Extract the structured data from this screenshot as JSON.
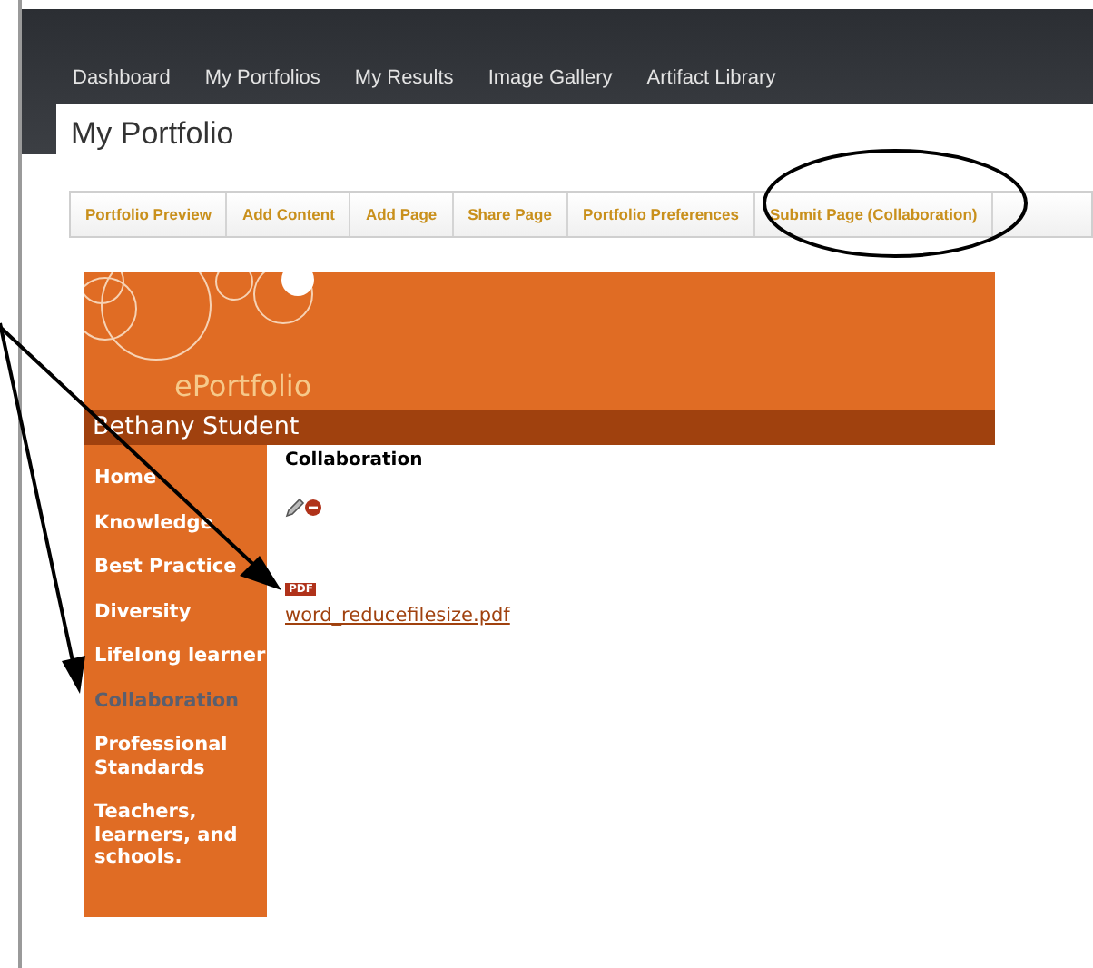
{
  "nav": [
    {
      "label": "Dashboard"
    },
    {
      "label": "My Portfolios"
    },
    {
      "label": "My Results"
    },
    {
      "label": "Image Gallery"
    },
    {
      "label": "Artifact Library"
    }
  ],
  "page_title": "My Portfolio",
  "tabs": [
    {
      "label": "Portfolio Preview"
    },
    {
      "label": "Add Content"
    },
    {
      "label": "Add Page"
    },
    {
      "label": "Share Page"
    },
    {
      "label": "Portfolio Preferences"
    },
    {
      "label": "Submit Page (Collaboration)"
    }
  ],
  "banner": {
    "title": "ePortfolio",
    "name": "Bethany Student"
  },
  "sidebar": {
    "items": [
      {
        "label": "Home",
        "selected": false
      },
      {
        "label": "Knowledge",
        "selected": false
      },
      {
        "label": "Best Practice",
        "selected": false
      },
      {
        "label": "Diversity",
        "selected": false
      },
      {
        "label": "Lifelong learner",
        "selected": false
      },
      {
        "label": "Collaboration",
        "selected": true
      },
      {
        "label": "Professional Standards",
        "selected": false
      },
      {
        "label": "Teachers, learners, and schools.",
        "selected": false
      }
    ]
  },
  "content": {
    "heading": "Collaboration",
    "attachment": {
      "badge": "PDF",
      "file": "word_reducefilesize.pdf"
    }
  }
}
